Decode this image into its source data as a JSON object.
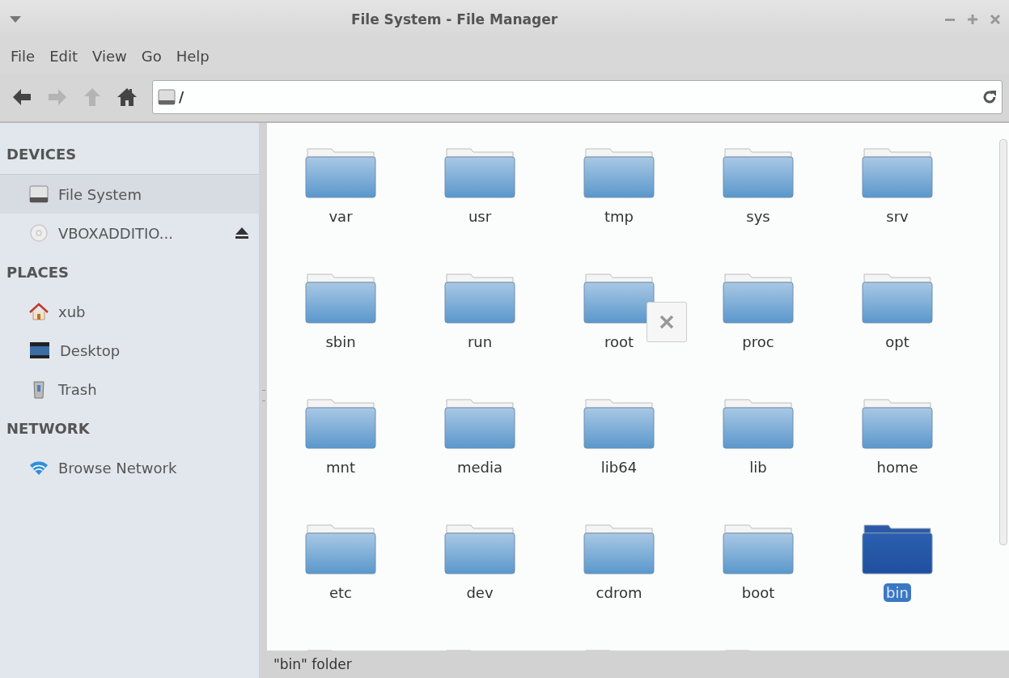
{
  "window": {
    "title": "File System - File Manager"
  },
  "menu": [
    "File",
    "Edit",
    "View",
    "Go",
    "Help"
  ],
  "toolbar": {
    "buttons": [
      {
        "kind": "back",
        "disabled": false
      },
      {
        "kind": "forward",
        "disabled": true
      },
      {
        "kind": "up",
        "disabled": true
      },
      {
        "kind": "home",
        "disabled": false
      }
    ],
    "location": {
      "value": "/"
    }
  },
  "sidebar": {
    "sections": [
      {
        "heading": "DEVICES",
        "items": [
          {
            "label": "File System",
            "kind": "drive",
            "selected": true,
            "ejectable": false
          },
          {
            "label": "VBOXADDITIO...",
            "kind": "disc",
            "selected": false,
            "ejectable": true
          }
        ]
      },
      {
        "heading": "PLACES",
        "items": [
          {
            "label": "xub",
            "kind": "home",
            "selected": false,
            "ejectable": false
          },
          {
            "label": "Desktop",
            "kind": "desktop",
            "selected": false,
            "ejectable": false
          },
          {
            "label": "Trash",
            "kind": "trash",
            "selected": false,
            "ejectable": false
          }
        ]
      },
      {
        "heading": "NETWORK",
        "items": [
          {
            "label": "Browse Network",
            "kind": "network",
            "selected": false,
            "ejectable": false
          }
        ]
      }
    ]
  },
  "folders": [
    {
      "name": "var",
      "selected": false,
      "close_badge": false
    },
    {
      "name": "usr",
      "selected": false,
      "close_badge": false
    },
    {
      "name": "tmp",
      "selected": false,
      "close_badge": false
    },
    {
      "name": "sys",
      "selected": false,
      "close_badge": false
    },
    {
      "name": "srv",
      "selected": false,
      "close_badge": false
    },
    {
      "name": "sbin",
      "selected": false,
      "close_badge": false
    },
    {
      "name": "run",
      "selected": false,
      "close_badge": false
    },
    {
      "name": "root",
      "selected": false,
      "close_badge": true
    },
    {
      "name": "proc",
      "selected": false,
      "close_badge": false
    },
    {
      "name": "opt",
      "selected": false,
      "close_badge": false
    },
    {
      "name": "mnt",
      "selected": false,
      "close_badge": false
    },
    {
      "name": "media",
      "selected": false,
      "close_badge": false
    },
    {
      "name": "lib64",
      "selected": false,
      "close_badge": false
    },
    {
      "name": "lib",
      "selected": false,
      "close_badge": false
    },
    {
      "name": "home",
      "selected": false,
      "close_badge": false
    },
    {
      "name": "etc",
      "selected": false,
      "close_badge": false
    },
    {
      "name": "dev",
      "selected": false,
      "close_badge": false
    },
    {
      "name": "cdrom",
      "selected": false,
      "close_badge": false
    },
    {
      "name": "boot",
      "selected": false,
      "close_badge": false
    },
    {
      "name": "bin",
      "selected": true,
      "close_badge": false
    }
  ],
  "cut_off_items": [
    {
      "kind": "folder"
    },
    {
      "kind": "folder"
    },
    {
      "kind": "folder"
    },
    {
      "kind": "folder"
    }
  ],
  "status_bar": {
    "text": "\"bin\" folder"
  }
}
